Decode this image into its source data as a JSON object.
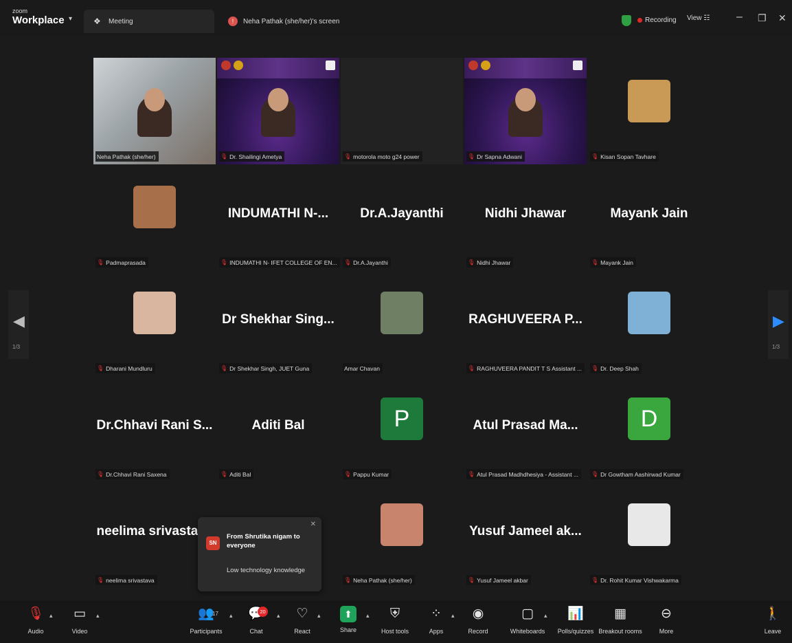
{
  "app": {
    "logo_small": "zoom",
    "logo_big": "Workplace",
    "tabs": [
      {
        "label": "Meeting",
        "icon": "meeting-people-icon"
      },
      {
        "label": "Neha Pathak (she/her)'s screen",
        "icon": "screen-share-icon"
      }
    ],
    "recording_label": "Recording",
    "view_label": "View"
  },
  "tiles": [
    {
      "type": "video",
      "bg": "office",
      "label": "Neha Pathak (she/her)",
      "muted": false,
      "highlight": true
    },
    {
      "type": "video",
      "bg": "purple",
      "label": "Dr. Shailingi Ametya",
      "muted": true
    },
    {
      "type": "video",
      "bg": "darkbox",
      "label": "motorola moto g24 power",
      "muted": true
    },
    {
      "type": "video",
      "bg": "purple",
      "label": "Dr Sapna Adwani",
      "muted": true
    },
    {
      "type": "thumb",
      "thumb": "#c89a56",
      "label": "Kisan Sopan Tavhare",
      "muted": true
    },
    {
      "type": "thumb",
      "thumb": "#a8704a",
      "label": "Padmaprasada",
      "muted": true
    },
    {
      "type": "name",
      "name": "INDUMATHI N-...",
      "label": "INDUMATHI N- IFET COLLEGE OF EN...",
      "muted": true
    },
    {
      "type": "name",
      "name": "Dr.A.Jayanthi",
      "label": "Dr.A.Jayanthi",
      "muted": true
    },
    {
      "type": "name",
      "name": "Nidhi Jhawar",
      "label": "Nidhi Jhawar",
      "muted": true
    },
    {
      "type": "name",
      "name": "Mayank Jain",
      "label": "Mayank Jain",
      "muted": true
    },
    {
      "type": "thumb",
      "thumb": "#d9b6a0",
      "label": "Dharani Mundluru",
      "muted": true
    },
    {
      "type": "name",
      "name": "Dr Shekhar Sing...",
      "label": "Dr Shekhar Singh, JUET Guna",
      "muted": true
    },
    {
      "type": "thumb",
      "thumb": "#6f7f63",
      "label": "Amar Chavan",
      "muted": false
    },
    {
      "type": "name",
      "name": "RAGHUVEERA P...",
      "label": "RAGHUVEERA PANDIT T S Assistant ...",
      "muted": true
    },
    {
      "type": "thumb",
      "thumb": "#7fb0d6",
      "label": "Dr. Deep Shah",
      "muted": true
    },
    {
      "type": "name",
      "name": "Dr.Chhavi Rani S...",
      "label": "Dr.Chhavi Rani Saxena",
      "muted": true
    },
    {
      "type": "name",
      "name": "Aditi Bal",
      "label": "Aditi Bal",
      "muted": true
    },
    {
      "type": "initial",
      "initial": "P",
      "color": "#1d7a3a",
      "label": "Pappu Kumar",
      "muted": true
    },
    {
      "type": "name",
      "name": "Atul Prasad Ma...",
      "label": "Atul Prasad Madhdhesiya - Assistant ...",
      "muted": true
    },
    {
      "type": "initial",
      "initial": "D",
      "color": "#3aa63e",
      "label": "Dr Gowtham Aashirwad Kumar",
      "muted": true
    },
    {
      "type": "name",
      "name": "neelima srivastava",
      "label": "neelima srivastava",
      "muted": true
    },
    {
      "type": "blank",
      "label": "",
      "muted": false
    },
    {
      "type": "thumb",
      "thumb": "#c9846e",
      "label": "Neha Pathak (she/her)",
      "muted": true
    },
    {
      "type": "name",
      "name": "Yusuf Jameel ak...",
      "label": "Yusuf Jameel akbar",
      "muted": true
    },
    {
      "type": "thumb",
      "thumb": "#e8e8e8",
      "label": "Dr. Rohit Kumar Vishwakarma",
      "muted": true
    }
  ],
  "pagination": {
    "left": "1/3",
    "right": "1/3"
  },
  "chat_popup": {
    "avatar_initials": "SN",
    "from": "From Shrutika nigam to everyone",
    "message": "Low technology knowledge"
  },
  "toolbar": [
    {
      "id": "audio",
      "label": "Audio",
      "icon": "microphone-muted-icon",
      "glyph": "🎙"
    },
    {
      "id": "video",
      "label": "Video",
      "icon": "video-camera-icon",
      "glyph": "▭"
    },
    {
      "id": "participants",
      "label": "Participants",
      "icon": "participants-icon",
      "glyph": "👥",
      "count": "17"
    },
    {
      "id": "chat",
      "label": "Chat",
      "icon": "chat-icon",
      "glyph": "💬",
      "badge": "20"
    },
    {
      "id": "react",
      "label": "React",
      "icon": "react-heart-icon",
      "glyph": "♡"
    },
    {
      "id": "share",
      "label": "Share",
      "icon": "share-screen-icon",
      "glyph": "⬆"
    },
    {
      "id": "host_tools",
      "label": "Host tools",
      "icon": "shield-icon",
      "glyph": "⛨"
    },
    {
      "id": "apps",
      "label": "Apps",
      "icon": "apps-icon",
      "glyph": "⁘"
    },
    {
      "id": "record",
      "label": "Record",
      "icon": "record-icon",
      "glyph": "◉"
    },
    {
      "id": "whiteboards",
      "label": "Whiteboards",
      "icon": "whiteboard-icon",
      "glyph": "▢"
    },
    {
      "id": "polls",
      "label": "Polls/quizzes",
      "icon": "poll-icon",
      "glyph": "📊"
    },
    {
      "id": "breakout",
      "label": "Breakout rooms",
      "icon": "breakout-rooms-icon",
      "glyph": "▦"
    },
    {
      "id": "more",
      "label": "More",
      "icon": "more-icon",
      "glyph": "⊖"
    },
    {
      "id": "leave",
      "label": "Leave",
      "icon": "leave-icon",
      "glyph": "🚶"
    }
  ],
  "colors": {
    "accent_green": "#1fa35a",
    "record_red": "#e02828",
    "leave_red": "#d93025",
    "share_green": "#1fa35a"
  }
}
